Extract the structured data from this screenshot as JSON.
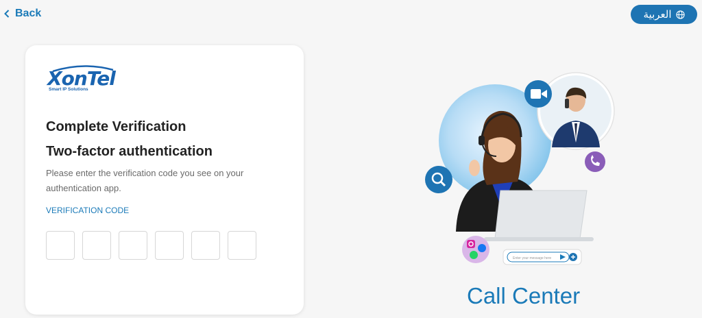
{
  "nav": {
    "back_label": "Back",
    "back_icon": "chevron-left-icon"
  },
  "language": {
    "label": "العربية",
    "icon": "globe-icon"
  },
  "brand": {
    "logo_text": "XonTel",
    "tagline": "Smart IP Solutions",
    "color": "#1a64b0"
  },
  "verification": {
    "title": "Complete Verification",
    "subtitle": "Two-factor authentication",
    "description": "Please enter the verification code you see on your authentication app.",
    "code_label": "VERIFICATION CODE",
    "code_length": 6
  },
  "illustration": {
    "message_placeholder": "Enter your message here",
    "caption": "Call Center"
  },
  "colors": {
    "accent": "#1a7ab8",
    "button_bg": "#1e74b3",
    "page_bg": "#f6f6f6"
  }
}
